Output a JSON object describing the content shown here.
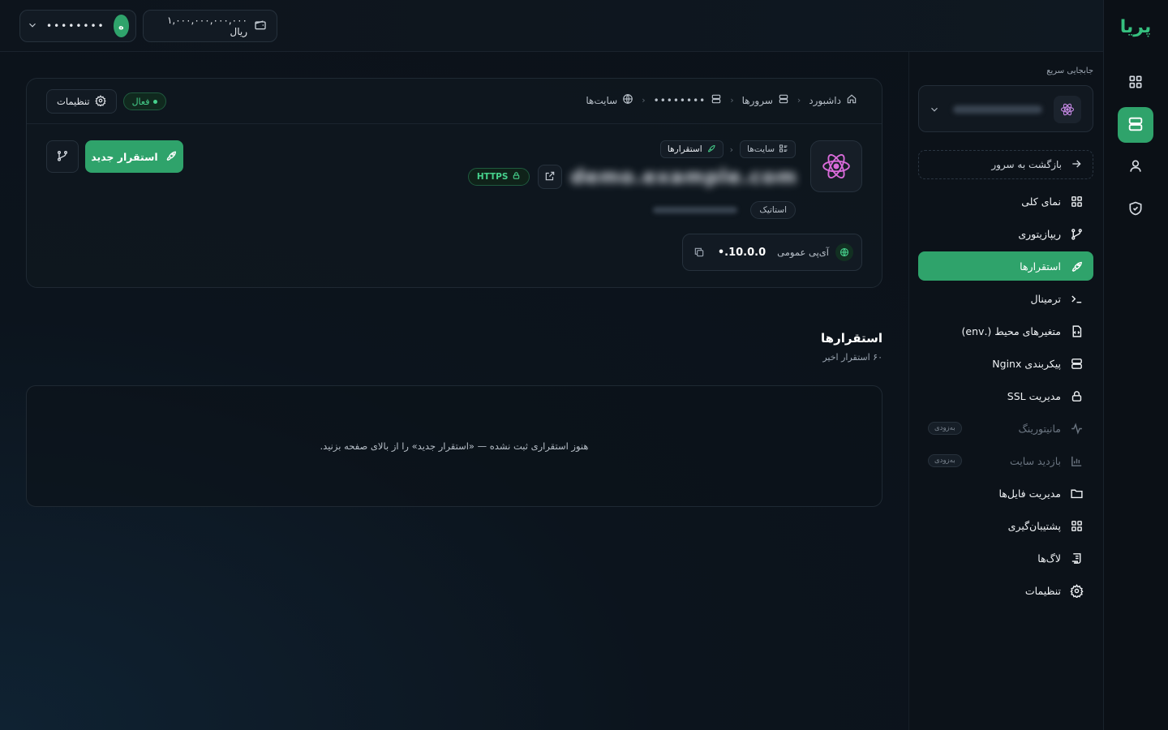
{
  "brand": {
    "logo_text": "پریا",
    "accent": "#2fa36b"
  },
  "topbar": {
    "wallet": {
      "balance": "۱,۰۰۰,۰۰۰,۰۰۰,۰۰۰ ریال",
      "icon": "wallet-icon"
    },
    "user": {
      "avatar_letter": "ه",
      "name": "••••••••",
      "icon": "chevron-down-icon"
    }
  },
  "icon_rail": {
    "items": [
      {
        "name": "dashboard",
        "icon": "grid-icon"
      },
      {
        "name": "servers",
        "icon": "server-icon",
        "active": true
      },
      {
        "name": "account",
        "icon": "user-icon"
      },
      {
        "name": "security",
        "icon": "shield-icon"
      }
    ]
  },
  "sidebar": {
    "quick_switch_label": "جابجایی سریع",
    "server_select": {
      "name": "••••••••••••",
      "icon": "react-icon"
    },
    "back_label": "بازگشت به سرور",
    "items": [
      {
        "label": "نمای کلی",
        "icon": "grid-icon"
      },
      {
        "label": "ریپازیتوری",
        "icon": "git-branch-icon"
      },
      {
        "label": "استقرارها",
        "icon": "rocket-icon",
        "active": true
      },
      {
        "label": "ترمینال",
        "icon": "terminal-icon"
      },
      {
        "label": "متغیرهای محیط (.env)",
        "icon": "file-code-icon"
      },
      {
        "label": "پیکربندی Nginx",
        "icon": "server-icon"
      },
      {
        "label": "مدیریت SSL",
        "icon": "lock-icon"
      },
      {
        "label": "مانیتورینگ",
        "icon": "activity-icon",
        "disabled": true,
        "badge": "به‌زودی"
      },
      {
        "label": "بازدید سایت",
        "icon": "bar-chart-icon",
        "disabled": true,
        "badge": "به‌زودی"
      },
      {
        "label": "مدیریت فایل‌ها",
        "icon": "folder-icon"
      },
      {
        "label": "پشتیبان‌گیری",
        "icon": "grid-icon"
      },
      {
        "label": "لاگ‌ها",
        "icon": "scroll-icon"
      },
      {
        "label": "تنظیمات",
        "icon": "gear-icon"
      }
    ]
  },
  "breadcrumb": [
    {
      "label": "داشبورد",
      "icon": "home-icon"
    },
    {
      "label": "سرورها",
      "icon": "server-icon"
    },
    {
      "label": "••••••••",
      "icon": "server-icon"
    },
    {
      "label": "سایت‌ها",
      "icon": "globe-icon"
    }
  ],
  "site": {
    "status": "فعال",
    "settings_label": "تنظیمات",
    "sub_crumbs": [
      {
        "label": "سایت‌ها"
      },
      {
        "label": "استقرارها"
      }
    ],
    "domain": "demo.example.com",
    "https_label": "HTTPS",
    "type": "استاتیک",
    "meta": "••••••••••••",
    "ip_label": "آی‌پی عمومی",
    "ip_value": "10.0.0.•",
    "deploy_label": "استقرار جدید"
  },
  "deployments": {
    "title": "استقرارها",
    "subtitle": "۶۰ استقرار اخیر",
    "empty_text": "هنوز استقراری ثبت نشده — «استقرار جدید» را از بالای صفحه بزنید."
  }
}
